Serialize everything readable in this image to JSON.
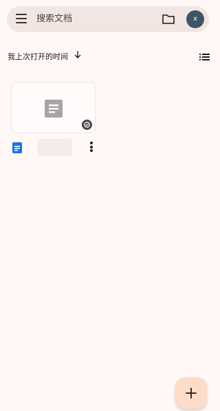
{
  "search": {
    "placeholder": "搜索文档"
  },
  "account": {
    "initial": "x",
    "color": "#3d5566"
  },
  "sort": {
    "label": "我上次打开的时间",
    "direction": "descending"
  },
  "documents": [
    {
      "title": "",
      "type_icon": "google-docs-icon",
      "thumbnail_icon": "document-placeholder-icon",
      "synced": true
    }
  ],
  "icons": {
    "menu": "menu-icon",
    "folder": "folder-icon",
    "sort_arrow": "arrow-down-icon",
    "list_view": "list-view-icon",
    "more": "more-vertical-icon",
    "fab": "plus-icon"
  },
  "colors": {
    "background": "#fff8f6",
    "search_bar": "#f2e6e2",
    "docs_blue": "#1a73e8",
    "fab": "#fcdcc8"
  }
}
